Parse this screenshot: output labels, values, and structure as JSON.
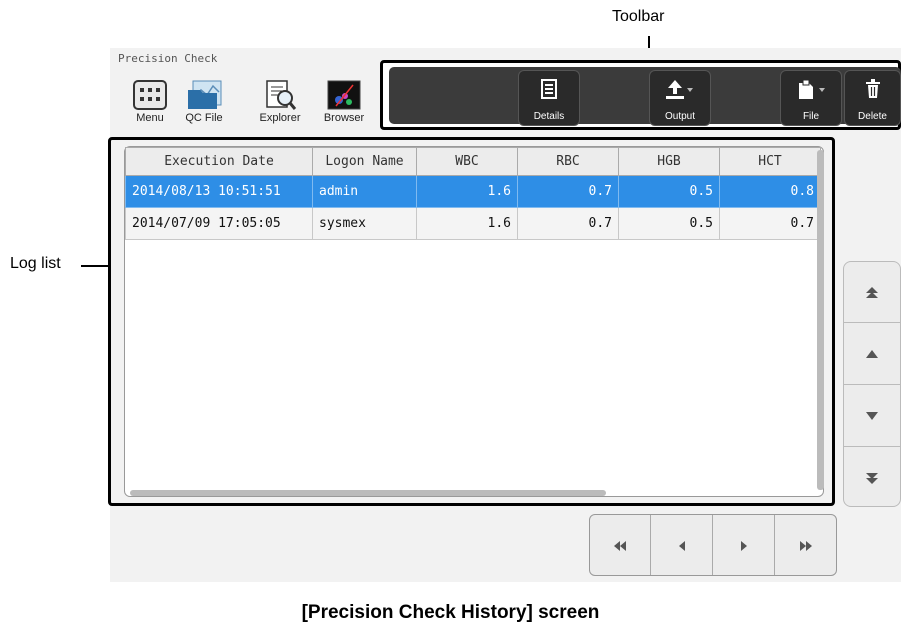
{
  "callouts": {
    "toolbar": "Toolbar",
    "log_list": "Log list"
  },
  "app": {
    "title": "Precision Check"
  },
  "nav": [
    {
      "label": "Menu",
      "icon": "menu-grid-icon"
    },
    {
      "label": "QC File",
      "icon": "qc-file-icon"
    },
    {
      "label": "Explorer",
      "icon": "explorer-icon"
    },
    {
      "label": "Browser",
      "icon": "browser-icon"
    }
  ],
  "toolbar": {
    "details": "Details",
    "output": "Output",
    "file": "File",
    "delete": "Delete"
  },
  "table": {
    "columns": [
      "Execution Date",
      "Logon Name",
      "WBC",
      "RBC",
      "HGB",
      "HCT"
    ],
    "rows": [
      {
        "date": "2014/08/13 10:51:51",
        "user": "admin",
        "wbc": "1.6",
        "rbc": "0.7",
        "hgb": "0.5",
        "hct": "0.8",
        "selected": true
      },
      {
        "date": "2014/07/09 17:05:05",
        "user": "sysmex",
        "wbc": "1.6",
        "rbc": "0.7",
        "hgb": "0.5",
        "hct": "0.7",
        "selected": false
      }
    ]
  },
  "scroll_buttons": [
    "scroll-top-icon",
    "scroll-up-icon",
    "scroll-down-icon",
    "scroll-bottom-icon"
  ],
  "pager_buttons": [
    "first-page-icon",
    "previous-page-icon",
    "next-page-icon",
    "last-page-icon"
  ],
  "colors": {
    "selected_row": "#2e8ee6",
    "toolbar_bg": "#3b3b3b"
  },
  "caption": "[Precision Check History] screen"
}
